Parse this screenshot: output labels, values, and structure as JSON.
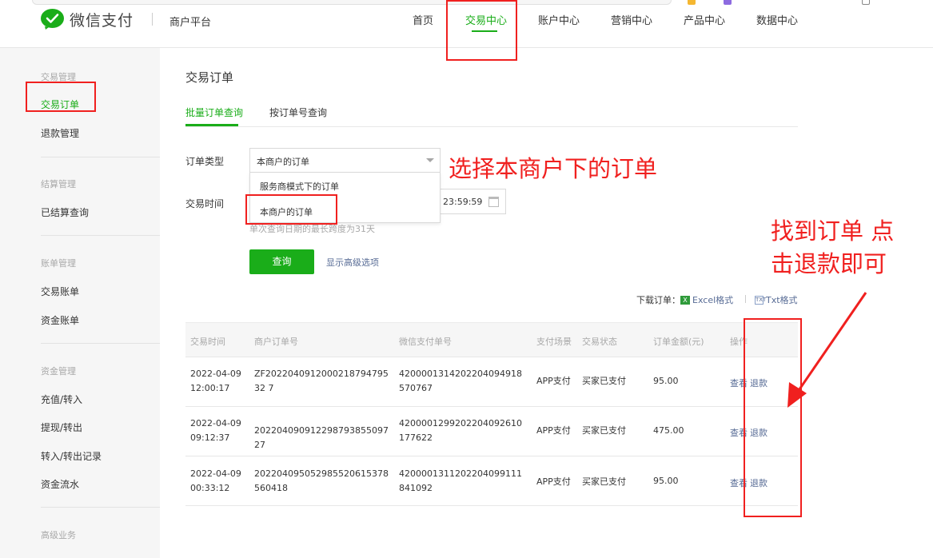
{
  "header": {
    "logo_text": "微信支付",
    "platform": "商户平台",
    "nav": [
      "首页",
      "交易中心",
      "账户中心",
      "营销中心",
      "产品中心",
      "数据中心"
    ],
    "active_nav": "交易中心"
  },
  "sidebar": {
    "groups": [
      {
        "title": "交易管理",
        "items": [
          "交易订单",
          "退款管理"
        ]
      },
      {
        "title": "结算管理",
        "items": [
          "已结算查询"
        ]
      },
      {
        "title": "账单管理",
        "items": [
          "交易账单",
          "资金账单"
        ]
      },
      {
        "title": "资金管理",
        "items": [
          "充值/转入",
          "提现/转出",
          "转入/转出记录",
          "资金流水"
        ]
      },
      {
        "title": "高级业务",
        "items": []
      }
    ],
    "active_item": "交易订单"
  },
  "main": {
    "title": "交易订单",
    "tabs": [
      "批量订单查询",
      "按订单号查询"
    ],
    "form": {
      "order_type_label": "订单类型",
      "order_type_value": "本商户的订单",
      "dropdown_options": [
        "服务商模式下的订单",
        "本商户的订单"
      ],
      "time_label": "交易时间",
      "end_time": "23:59:59",
      "hint": "单次查询日期的最长跨度为31天",
      "query_button": "查询",
      "advanced_link": "显示高级选项"
    },
    "download": {
      "label": "下载订单：",
      "excel": "Excel格式",
      "txt": "Txt格式",
      "excel_icon": "X",
      "txt_icon": "TXT"
    },
    "table": {
      "columns": [
        "交易时间",
        "商户订单号",
        "微信支付单号",
        "支付场景",
        "交易状态",
        "订单金额(元)",
        "操作"
      ],
      "rows": [
        {
          "time": "2022-04-09 12:00:17",
          "merchant_no": "ZF202204091200021879479532 7",
          "wx_no": "4200001314202204094918570767",
          "scene": "APP支付",
          "status": "买家已支付",
          "amount": "95.00",
          "view": "查看",
          "refund": "退款"
        },
        {
          "time": "2022-04-09 09:12:37",
          "merchant_no": "20220409091229879385509727",
          "wx_no": "4200001299202204092610177622",
          "scene": "APP支付",
          "status": "买家已支付",
          "amount": "475.00",
          "view": "查看",
          "refund": "退款"
        },
        {
          "time": "2022-04-09 00:33:12",
          "merchant_no": "202204095052985520615378560418",
          "wx_no": "4200001311202204099111841092",
          "scene": "APP支付",
          "status": "买家已支付",
          "amount": "95.00",
          "view": "查看",
          "refund": "退款"
        }
      ]
    }
  },
  "annotations": {
    "select_note": "选择本商户下的订单",
    "refund_note_line1": "找到订单 点",
    "refund_note_line2": "击退款即可",
    "color": "#f0201f"
  },
  "colors": {
    "brand_green": "#1aad19",
    "link_blue": "#576b95"
  }
}
